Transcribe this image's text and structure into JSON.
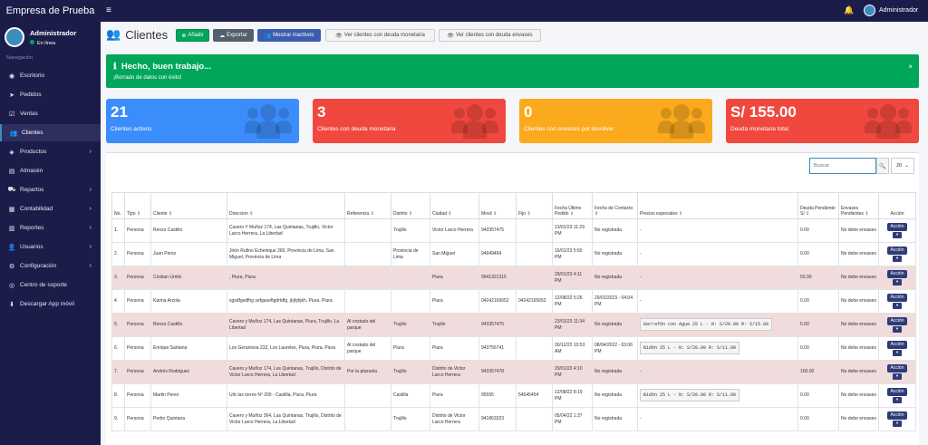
{
  "app": {
    "brand": "Empresa de Prueba",
    "user": "Administrador",
    "status": "En línea",
    "nav_header": "Navegación"
  },
  "nav": [
    {
      "label": "Escritorio",
      "icon": "dashboard-icon",
      "glyph": "◉",
      "chevron": false,
      "active": false
    },
    {
      "label": "Pedidos",
      "icon": "paper-plane-icon",
      "glyph": "➤",
      "chevron": false,
      "active": false
    },
    {
      "label": "Ventas",
      "icon": "check-square-icon",
      "glyph": "☑",
      "chevron": false,
      "active": false
    },
    {
      "label": "Clientes",
      "icon": "users-icon",
      "glyph": "👥",
      "chevron": false,
      "active": true
    },
    {
      "label": "Productos",
      "icon": "box-icon",
      "glyph": "◈",
      "chevron": true,
      "active": false
    },
    {
      "label": "Almacén",
      "icon": "warehouse-icon",
      "glyph": "▤",
      "chevron": false,
      "active": false
    },
    {
      "label": "Repartos",
      "icon": "truck-icon",
      "glyph": "⛟",
      "chevron": true,
      "active": false
    },
    {
      "label": "Contabilidad",
      "icon": "calculator-icon",
      "glyph": "▦",
      "chevron": true,
      "active": false
    },
    {
      "label": "Reportes",
      "icon": "bar-chart-icon",
      "glyph": "▥",
      "chevron": true,
      "active": false
    },
    {
      "label": "Usuarios",
      "icon": "user-icon",
      "glyph": "👤",
      "chevron": true,
      "active": false
    },
    {
      "label": "Configuración",
      "icon": "cogs-icon",
      "glyph": "⚙",
      "chevron": true,
      "active": false
    },
    {
      "label": "Centro de soporte",
      "icon": "support-icon",
      "glyph": "◎",
      "chevron": false,
      "active": false
    },
    {
      "label": "Descargar App móvil",
      "icon": "download-icon",
      "glyph": "⬇",
      "chevron": false,
      "active": false
    }
  ],
  "page": {
    "title": "Clientes"
  },
  "toolbar": {
    "add": "Añadir",
    "export": "Exportar",
    "show_inactive": "Mostrar inactivos",
    "debt_money": "Ver clientes con deuda monetaria",
    "debt_containers": "Ver clientes con deuda envases"
  },
  "alert": {
    "title": "Hecho, buen trabajo...",
    "message": "¡Borrado de datos con éxito!",
    "close": "×"
  },
  "stats": [
    {
      "value": "21",
      "label": "Clientes activos",
      "color": "#3c8dfc"
    },
    {
      "value": "3",
      "label": "Clientes con deuda monetaria",
      "color": "#f0483e"
    },
    {
      "value": "0",
      "label": "Clientes con envases por devolver",
      "color": "#fbaa1e"
    },
    {
      "value": "S/ 155.00",
      "label": "Deuda monetaria total",
      "color": "#f0483e"
    }
  ],
  "search": {
    "placeholder": "Buscar",
    "page_size": "20"
  },
  "columns": [
    "No.",
    "Tipo",
    "Cliente",
    "Direccion",
    "Referencia",
    "Distrito",
    "Ciudad",
    "Movil",
    "Fijo",
    "Fecha Último Pedido",
    "Fecha de Contacto",
    "Precios especiales",
    "Deuda Pendiente S/",
    "Envases Pendientes",
    "Acción"
  ],
  "action_label": "Acción",
  "rows": [
    {
      "no": "1.",
      "tipo": "Persona",
      "cliente": "Renzo Castillo",
      "dir": "Cavero Y Muñoz 174, Las Quintanas, Trujillo, Victor Larco Herrera, La Libertad",
      "ref": "",
      "dist": "Trujillo",
      "ciudad": "Victor Larco Herrera",
      "movil": "943357475",
      "fijo": "",
      "fped": "13/01/23 11:29 PM",
      "fcont": "No registrada",
      "precios": "-",
      "deuda": "0.00",
      "env": "No debe envases",
      "pink": false
    },
    {
      "no": "2.",
      "tipo": "Persona",
      "cliente": "Juan Perez",
      "dir": "Jirón Rufino Echenique 260, Provincia de Lima, San Miguel, Provincia de Lima",
      "ref": "",
      "dist": "Provincia de Lima",
      "ciudad": "San Miguel",
      "movil": "94949494",
      "fijo": "",
      "fped": "16/01/23 5:50 PM",
      "fcont": "No registrada",
      "precios": "-",
      "deuda": "0.00",
      "env": "No debe envases",
      "pink": false
    },
    {
      "no": "3.",
      "tipo": "Persona",
      "cliente": "Cristian Urriilo",
      "dir": ", Piura, Piura",
      "ref": "",
      "dist": "",
      "ciudad": "Piura",
      "movil": "9541321315",
      "fijo": "",
      "fped": "29/01/23 4:11 PM",
      "fcont": "No registrada",
      "precios": "-",
      "deuda": "50.00",
      "env": "No debe envases",
      "pink": true
    },
    {
      "no": "4.",
      "tipo": "Persona",
      "cliente": "Karina Arzola",
      "dir": "sgsdfgsdfhg sefgaseftgdrtdfg, jkjhjhjkh, Piura, Piura",
      "ref": "",
      "dist": "",
      "ciudad": "Piura",
      "movil": "04242165652",
      "fijo": "04242165652",
      "fped": "12/08/22 5:26 PM",
      "fcont": "29/01/2023 - 04:04 PM",
      "precios": "-",
      "deuda": "0.00",
      "env": "No debe envases",
      "pink": false
    },
    {
      "no": "5.",
      "tipo": "Persona",
      "cliente": "Renzo Castillo",
      "dir": "Cavero y Muñoz 174, Las Quintanas, Piura, Trujillo, La Libertad",
      "ref": "Al costado del parque",
      "dist": "Trujillo",
      "ciudad": "Trujillo",
      "movil": "943357475",
      "fijo": "",
      "fped": "23/01/23 11:34 PM",
      "fcont": "No registrada",
      "precios": "Garrafón con Agua 25 L -  N: S/20.00 R: S/15.00",
      "deuda": "5.00",
      "env": "No debe envases",
      "pink": true
    },
    {
      "no": "6.",
      "tipo": "Persona",
      "cliente": "Enrique Santana",
      "dir": "Los Geraniosa 232, Los Laureles, Piura, Piura, Piura",
      "ref": "Al costado del parque",
      "dist": "Piura",
      "ciudad": "Piura",
      "movil": "943756741",
      "fijo": "",
      "fped": "30/12/22 10:53 AM",
      "fcont": "08/04/2022 - 03:06 PM",
      "precios": "Bidón 25 L -  N: S/20.00 R: S/11.00",
      "deuda": "0.00",
      "env": "No debe envases",
      "pink": false
    },
    {
      "no": "7.",
      "tipo": "Persona",
      "cliente": "Andrés Rodriguez",
      "dir": "Cavero y Muñoz 174, Las Quintanas, Trujillo, Distrito de Victor Larco Herrera, La Libertad",
      "ref": "Por la plazuela",
      "dist": "Trujillo",
      "ciudad": "Distrito de Victor Larco Herrera",
      "movil": "943357478",
      "fijo": "",
      "fped": "29/01/23 4:10 PM",
      "fcont": "No registrada",
      "precios": "-",
      "deuda": "100.00",
      "env": "No debe envases",
      "pink": true
    },
    {
      "no": "8.",
      "tipo": "Persona",
      "cliente": "Martin Perez",
      "dir": "Urb las torres Nº 200 - Castilla, Piura, Piura",
      "ref": "",
      "dist": "Castilla",
      "ciudad": "Piura",
      "movil": "95555",
      "fijo": "54545454",
      "fped": "12/08/22 8:19 PM",
      "fcont": "No registrada",
      "precios": "Bidón 25 L -  N: S/20.00 R: S/11.00",
      "deuda": "0.00",
      "env": "No debe envases",
      "pink": false
    },
    {
      "no": "9.",
      "tipo": "Persona",
      "cliente": "Pedro Quintana",
      "dir": "Cavero y Muñoz 364, Las Quintanas, Trujillo, Distrito de Victor Larco Herrera, La Libertad",
      "ref": "",
      "dist": "Trujillo",
      "ciudad": "Distrito de Victor Larco Herrera",
      "movil": "941863323",
      "fijo": "",
      "fped": "05/04/22 1:37 PM",
      "fcont": "No registrada",
      "precios": "-",
      "deuda": "0.00",
      "env": "No debe envases",
      "pink": false
    }
  ]
}
